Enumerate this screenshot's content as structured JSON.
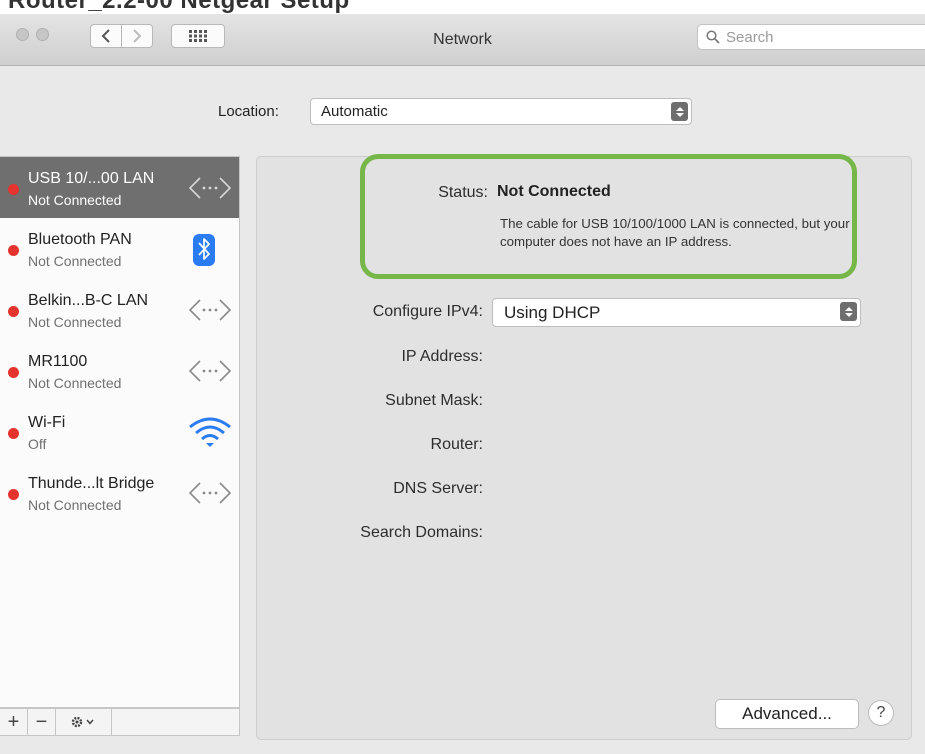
{
  "window": {
    "top_title": "Router_2.2-00 Netgear Setup",
    "title": "Network",
    "search_placeholder": "Search"
  },
  "location": {
    "label": "Location:",
    "value": "Automatic"
  },
  "services": [
    {
      "name": "USB 10/...00 LAN",
      "status": "Not Connected",
      "icon": "ethernet-icon",
      "selected": true,
      "dot_color": "#e5332e"
    },
    {
      "name": "Bluetooth PAN",
      "status": "Not Connected",
      "icon": "bluetooth-icon",
      "selected": false,
      "dot_color": "#e5332e"
    },
    {
      "name": "Belkin...B-C LAN",
      "status": "Not Connected",
      "icon": "ethernet-icon",
      "selected": false,
      "dot_color": "#e5332e"
    },
    {
      "name": "MR1100",
      "status": "Not Connected",
      "icon": "ethernet-icon",
      "selected": false,
      "dot_color": "#e5332e"
    },
    {
      "name": "Wi-Fi",
      "status": "Off",
      "icon": "wifi-icon",
      "selected": false,
      "dot_color": "#e5332e"
    },
    {
      "name": "Thunde...lt Bridge",
      "status": "Not Connected",
      "icon": "ethernet-icon",
      "selected": false,
      "dot_color": "#e5332e"
    }
  ],
  "sidebar_controls": {
    "add": "+",
    "remove": "−"
  },
  "detail": {
    "status_label": "Status:",
    "status_value": "Not Connected",
    "status_description": "The cable for USB 10/100/1000 LAN is connected, but your computer does not have an IP address.",
    "configure_label": "Configure IPv4:",
    "configure_value": "Using DHCP",
    "ip_label": "IP Address:",
    "subnet_label": "Subnet Mask:",
    "router_label": "Router:",
    "dns_label": "DNS Server:",
    "search_domains_label": "Search Domains:",
    "advanced_button": "Advanced...",
    "help_button": "?"
  },
  "colors": {
    "highlight": "#76b74a",
    "status_dot": "#e5332e",
    "selected_row": "#6f6f6f",
    "bluetooth": "#2a7cf2",
    "wifi": "#2a7cf2"
  }
}
